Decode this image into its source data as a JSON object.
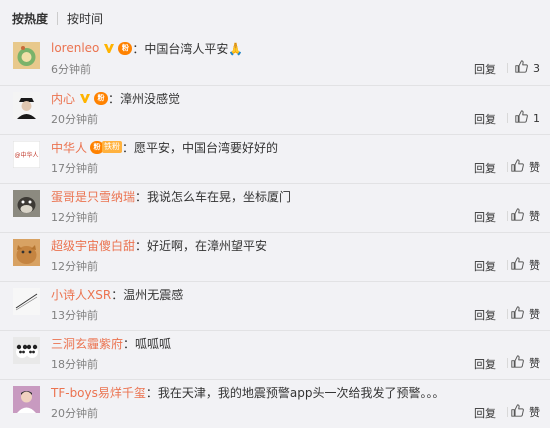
{
  "sort": {
    "hot": "按热度",
    "time": "按时间"
  },
  "comments": [
    {
      "user": "lorenleo",
      "verified": true,
      "fan": true,
      "fan_tag": "",
      "text": "中国台湾人平安🙏",
      "time": "6分钟前",
      "reply": "回复",
      "likes": "3",
      "avatar_color": "#e6c88a"
    },
    {
      "user": "内心",
      "verified": true,
      "fan": true,
      "fan_tag": "",
      "text": "漳州没感觉",
      "time": "20分钟前",
      "reply": "回复",
      "likes": "1",
      "avatar_color": "#2a2a2a"
    },
    {
      "user": "中华人",
      "verified": false,
      "fan": true,
      "fan_tag": "铁粉",
      "text": "愿平安，中国台湾要好好的",
      "time": "17分钟前",
      "reply": "回复",
      "likes": "赞",
      "avatar_color": "#ffffff"
    },
    {
      "user": "蛋哥是只雪纳瑞",
      "verified": false,
      "fan": false,
      "fan_tag": "",
      "text": "我说怎么车在晃，坐标厦门",
      "time": "12分钟前",
      "reply": "回复",
      "likes": "赞",
      "avatar_color": "#6b6358"
    },
    {
      "user": "超级宇宙傻白甜",
      "verified": false,
      "fan": false,
      "fan_tag": "",
      "text": "好近啊，在漳州望平安",
      "time": "12分钟前",
      "reply": "回复",
      "likes": "赞",
      "avatar_color": "#c08a4a"
    },
    {
      "user": "小诗人XSR",
      "verified": false,
      "fan": false,
      "fan_tag": "",
      "text": "温州无震感",
      "time": "13分钟前",
      "reply": "回复",
      "likes": "赞",
      "avatar_color": "#eeeeee"
    },
    {
      "user": "三洞玄霾紫府",
      "verified": false,
      "fan": false,
      "fan_tag": "",
      "text": "呱呱呱",
      "time": "18分钟前",
      "reply": "回复",
      "likes": "赞",
      "avatar_color": "#dcdcdc"
    },
    {
      "user": "TF-boys易烊千玺",
      "verified": false,
      "fan": false,
      "fan_tag": "",
      "text": "我在天津，我的地震预警app头一次给我发了预警。。。",
      "time": "20分钟前",
      "reply": "回复",
      "likes": "赞",
      "avatar_color": "#b78aa8"
    }
  ],
  "avatar2_text": "@中华人",
  "icons": {
    "verified": "verified-v-icon",
    "fan": "fan-badge-icon",
    "like": "thumbs-up-icon"
  }
}
